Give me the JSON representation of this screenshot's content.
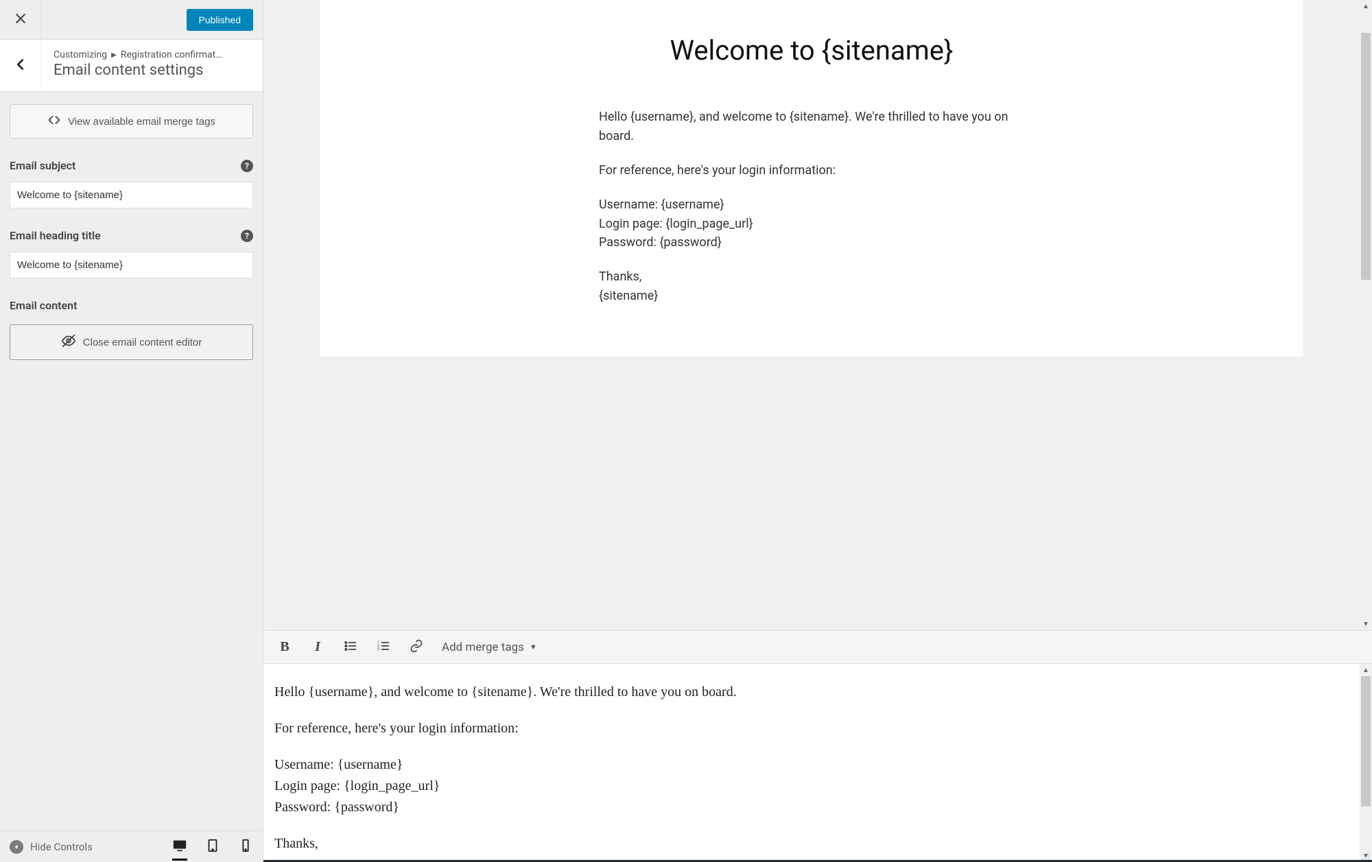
{
  "header": {
    "published_label": "Published"
  },
  "breadcrumb": {
    "root": "Customizing",
    "path": "Registration confirmat…",
    "title": "Email content settings"
  },
  "sidebar": {
    "merge_tags_button": "View available email merge tags",
    "subject_label": "Email subject",
    "subject_value": "Welcome to {sitename}",
    "heading_label": "Email heading title",
    "heading_value": "Welcome to {sitename}",
    "content_label": "Email content",
    "close_editor_button": "Close email content editor"
  },
  "footer": {
    "hide_controls": "Hide Controls"
  },
  "preview": {
    "heading": "Welcome to {sitename}",
    "para_intro": "Hello {username}, and welcome to {sitename}. We're thrilled to have you on board.",
    "para_ref": "For reference, here's your login information:",
    "line_username": "Username: {username}",
    "line_login": "Login page: {login_page_url}",
    "line_password": "Password: {password}",
    "line_thanks": "Thanks,",
    "line_sitename": "{sitename}"
  },
  "toolbar": {
    "merge_dropdown": "Add merge tags"
  },
  "editor": {
    "para_intro": "Hello {username}, and welcome to {sitename}. We're thrilled to have you on board.",
    "para_ref": "For reference, here's your login information:",
    "line_username": "Username: {username}",
    "line_login": "Login page: {login_page_url}",
    "line_password": "Password: {password}",
    "line_thanks": "Thanks,"
  }
}
